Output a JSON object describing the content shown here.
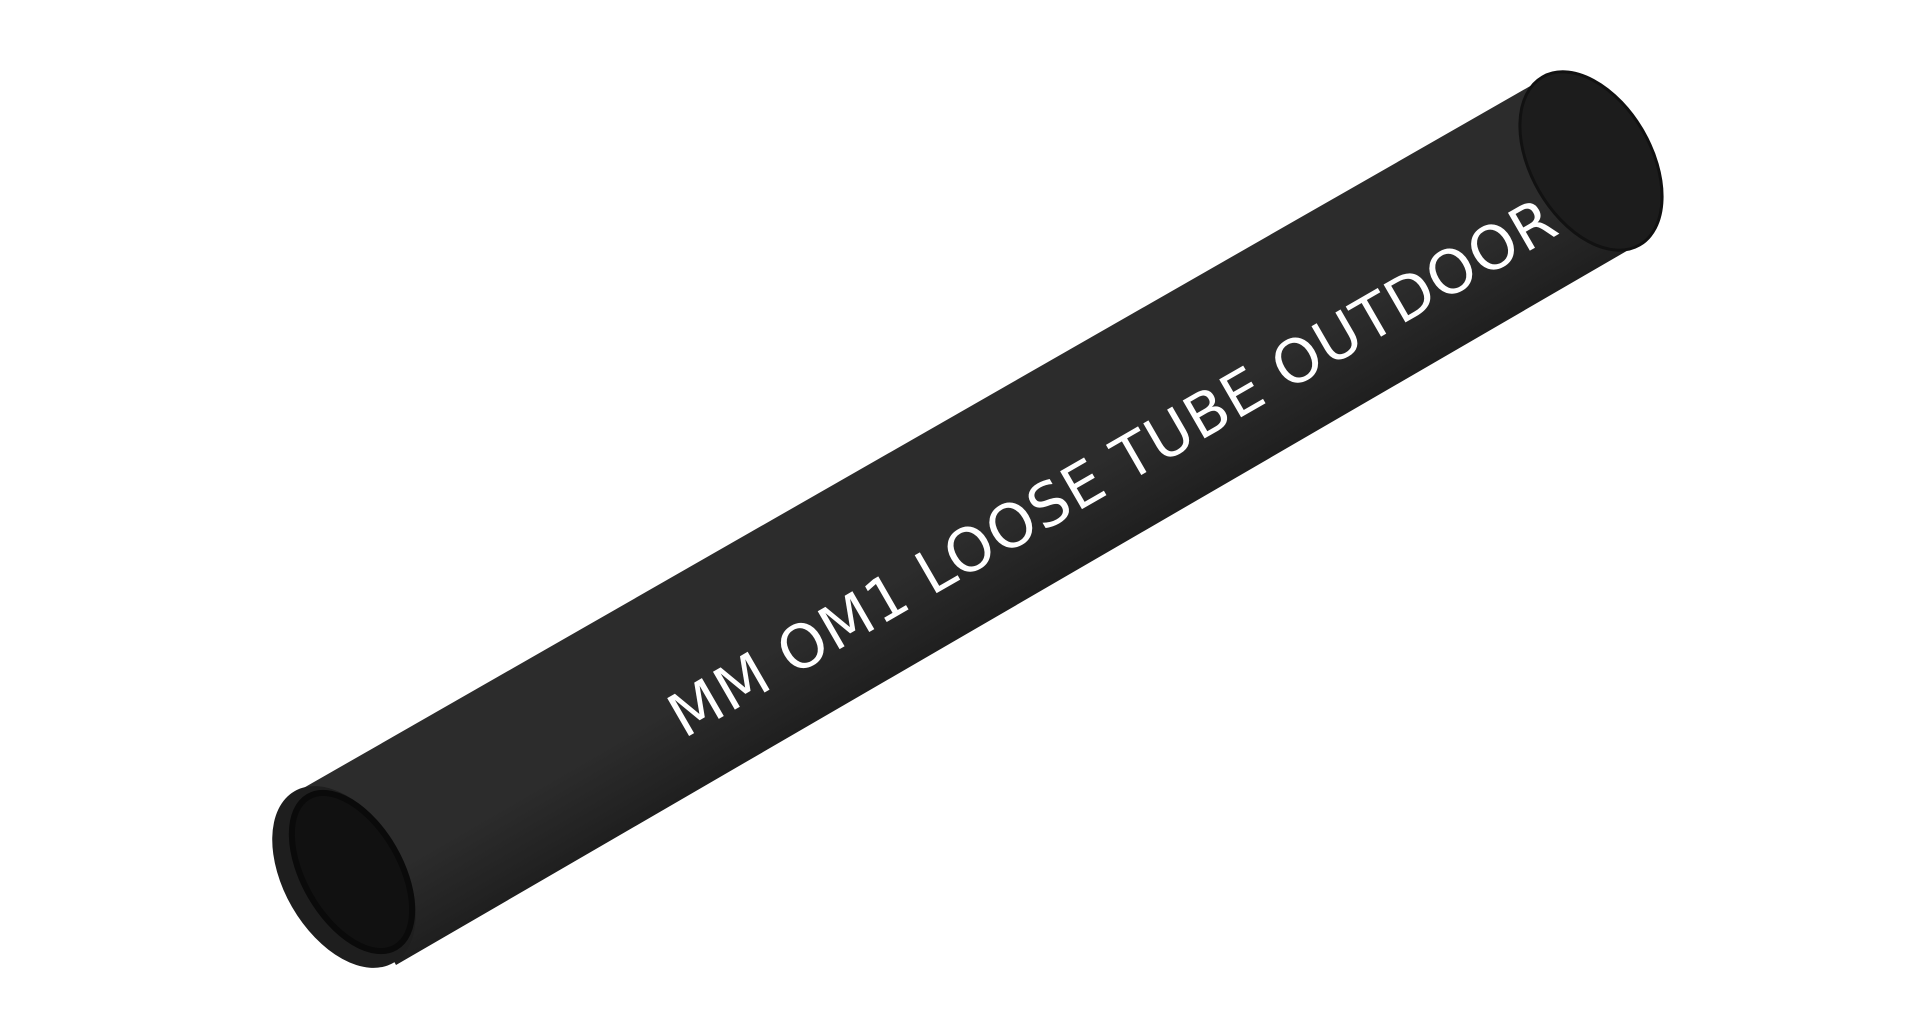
{
  "scene": {
    "subject": "tube-icon",
    "background_color": "#ffffff",
    "tube_color": "#1f1f1f",
    "tube_inner_color": "#111111",
    "label_color": "#ffffff",
    "label": "MM OM1 LOOSE TUBE OUTDOOR"
  }
}
